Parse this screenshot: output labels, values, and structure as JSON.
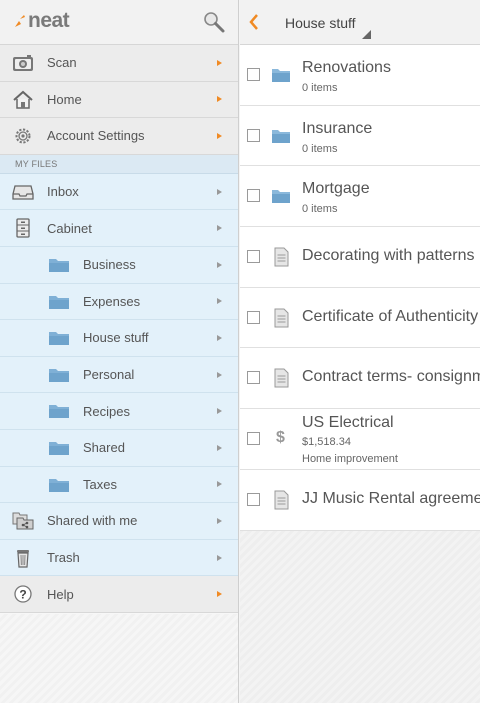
{
  "drawer": {
    "logo_text": "neat",
    "top_items": [
      {
        "label": "Scan",
        "icon": "camera-icon"
      },
      {
        "label": "Home",
        "icon": "home-icon"
      },
      {
        "label": "Account Settings",
        "icon": "gear-icon"
      }
    ],
    "section_label": "MY FILES",
    "files_items": [
      {
        "label": "Inbox",
        "icon": "inbox-icon"
      },
      {
        "label": "Cabinet",
        "icon": "cabinet-icon"
      }
    ],
    "cabinet_folders": [
      {
        "label": "Business"
      },
      {
        "label": "Expenses"
      },
      {
        "label": "House stuff"
      },
      {
        "label": "Personal"
      },
      {
        "label": "Recipes"
      },
      {
        "label": "Shared"
      },
      {
        "label": "Taxes"
      }
    ],
    "bottom_items": [
      {
        "label": "Shared with me",
        "icon": "shared-folder-icon"
      },
      {
        "label": "Trash",
        "icon": "trash-icon"
      }
    ],
    "help_label": "Help"
  },
  "content": {
    "folder_title": "House stuff",
    "items": [
      {
        "name": "Renovations",
        "sub": "0 items",
        "type": "folder"
      },
      {
        "name": "Insurance",
        "sub": "0 items",
        "type": "folder"
      },
      {
        "name": "Mortgage",
        "sub": "0 items",
        "type": "folder"
      },
      {
        "name": "Decorating with patterns",
        "type": "document"
      },
      {
        "name": "Certificate of Authenticity",
        "type": "document"
      },
      {
        "name": "Contract terms- consignment",
        "type": "document"
      },
      {
        "name": "US Electrical",
        "amount": "$1,518.34",
        "category": "Home improvement",
        "type": "receipt"
      },
      {
        "name": "JJ Music Rental agreement",
        "type": "document"
      }
    ]
  },
  "colors": {
    "accent": "#f08a24",
    "highlight_bg": "#e3f1fa",
    "folder_blue": "#6fa6cf"
  }
}
